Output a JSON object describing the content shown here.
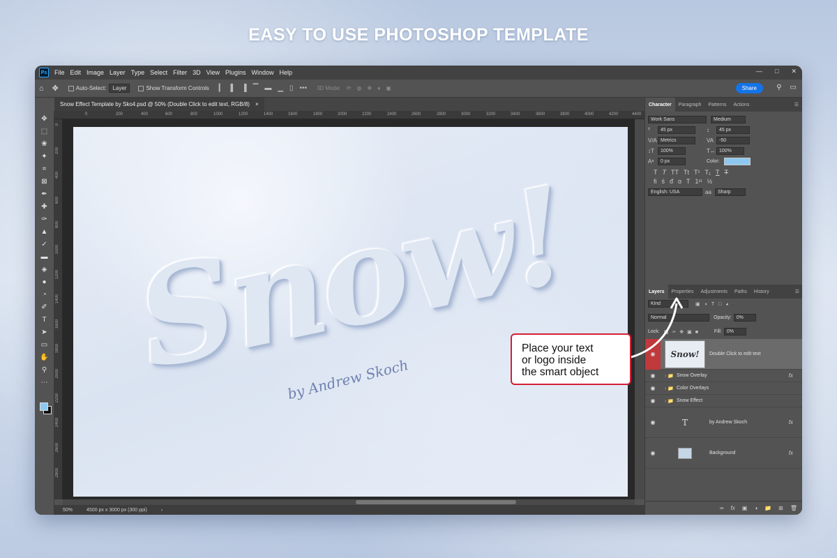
{
  "headline": "EASY TO USE PHOTOSHOP TEMPLATE",
  "app": {
    "logo": "Ps",
    "menu": [
      "File",
      "Edit",
      "Image",
      "Layer",
      "Type",
      "Select",
      "Filter",
      "3D",
      "View",
      "Plugins",
      "Window",
      "Help"
    ]
  },
  "options_bar": {
    "auto_select_label": "Auto-Select:",
    "auto_select_value": "Layer",
    "transform_label": "Show Transform Controls",
    "mode3d_label": "3D Mode:",
    "share_label": "Share"
  },
  "document": {
    "tab_title": "Snow Effect Template by Sko4.psd @ 50% (Double Click to edit text, RGB/8)",
    "close": "×",
    "canvas_word": "Snow!",
    "byline": "by Andrew Skoch",
    "ruler_top": [
      "0",
      "200",
      "400",
      "600",
      "800",
      "1000",
      "1200",
      "1400",
      "1600",
      "1800",
      "2000",
      "2200",
      "2400",
      "2600",
      "2800",
      "3000",
      "3200",
      "3400",
      "3600",
      "3800",
      "4000",
      "4200",
      "4400"
    ],
    "ruler_left": [
      "0",
      "200",
      "400",
      "600",
      "800",
      "1000",
      "1200",
      "1400",
      "1600",
      "1800",
      "2000",
      "2200",
      "2400",
      "2600",
      "2800"
    ]
  },
  "status": {
    "zoom": "50%",
    "doc_size": "4500 px x 3000 px (300 ppi)",
    "arrow": "›"
  },
  "character_panel": {
    "tabs": [
      "Character",
      "Paragraph",
      "Patterns",
      "Actions"
    ],
    "font_family": "Work Sans",
    "font_style": "Medium",
    "font_size": "45 px",
    "leading": "45 px",
    "kerning": "Metrics",
    "tracking": "-50",
    "vertical_scale": "100%",
    "horizontal_scale": "100%",
    "baseline_shift": "0 px",
    "color_label": "Color:",
    "color_value": "#8ec8f0",
    "language": "English: USA",
    "antialias_icon": "aa",
    "antialias": "Sharp"
  },
  "layers_panel": {
    "tabs": [
      "Layers",
      "Properties",
      "Adjustments",
      "Paths",
      "History"
    ],
    "filter_kind": "Kind",
    "blend_mode": "Normal",
    "opacity_label": "Opacity:",
    "opacity_value": "0%",
    "lock_label": "Lock:",
    "fill_label": "Fill:",
    "fill_value": "0%",
    "smart_thumb": "Snow!",
    "layers": [
      {
        "name": "Double Click to edit text",
        "type": "smart-object",
        "selected": true
      },
      {
        "name": "Snow Overlay",
        "type": "group",
        "fx": "fx"
      },
      {
        "name": "Color Overlays",
        "type": "group"
      },
      {
        "name": "Snow Effect",
        "type": "group"
      },
      {
        "name": "by Andrew Skoch",
        "type": "text",
        "fx": "fx"
      },
      {
        "name": "Background",
        "type": "image",
        "fx": "fx"
      }
    ]
  },
  "callout": {
    "line1": "Place your text",
    "line2": "or logo inside",
    "line3": "the smart object"
  }
}
